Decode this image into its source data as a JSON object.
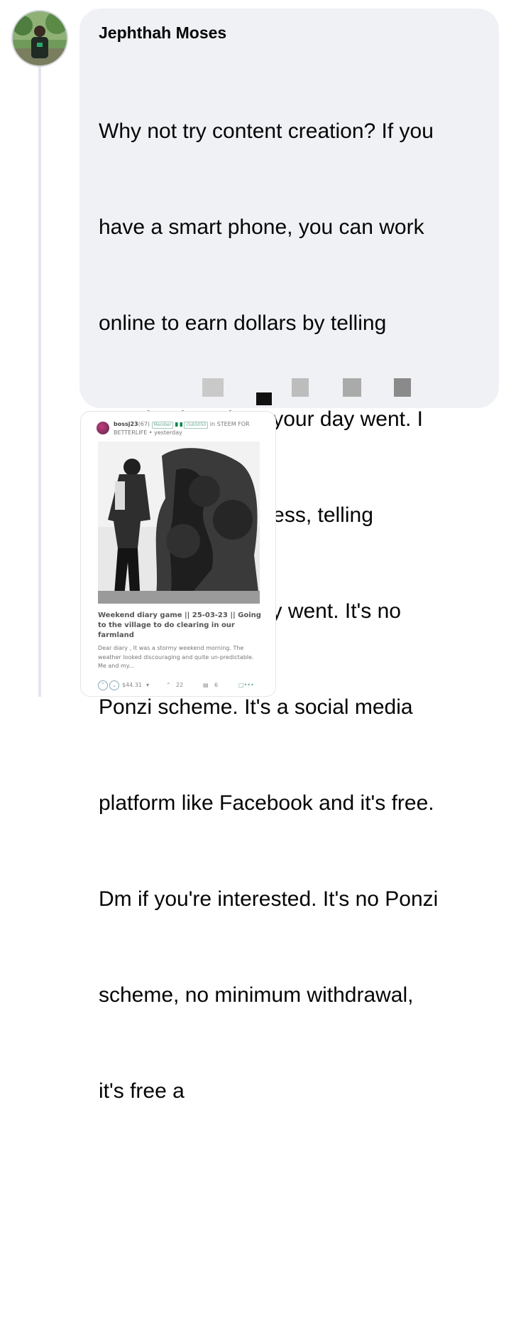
{
  "comment": {
    "author": "Jephthah Moses",
    "lines": [
      "Why not try content creation? If you",
      "have a smart phone, you can work",
      "online to earn dollars by telling",
      "people about how your day went. I",
      "got $44 without stress, telling",
      "people how my day went. It's no",
      "Ponzi scheme. It's a social media",
      "platform like Facebook and it's free.",
      "Dm if you're interested. It's no Ponzi",
      "scheme, no minimum withdrawal,",
      "it's free a"
    ]
  },
  "attachment": {
    "author": "bossj23",
    "reputation": "(67)",
    "member_badge": "Member",
    "club_badge": "club5050",
    "community": "in STEEM FOR BETTERLIFE",
    "time": "yesterday",
    "title": "Weekend diary game || 25-03-23 || Going to the village to do clearing in our farmland",
    "excerpt": "Dear diary , It was a stormy weekend morning. The weather looked discouraging and quite un-predictable. Me and my...",
    "payout": "$44.31",
    "votes": "22",
    "comments": "6"
  },
  "icons": {
    "upvote": "upvote-icon",
    "downvote": "downvote-icon",
    "votes": "votes-icon",
    "comments": "comments-icon",
    "reblog": "reblog-icon"
  }
}
